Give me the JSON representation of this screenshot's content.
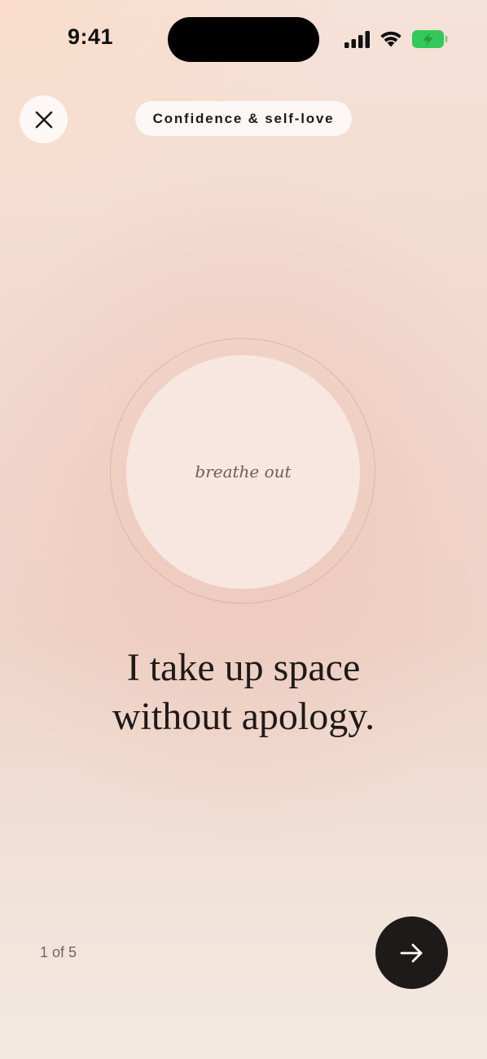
{
  "status_bar": {
    "time": "9:41",
    "icons": [
      "signal-icon",
      "wifi-icon",
      "battery-charging-icon"
    ],
    "battery_color": "#34c759"
  },
  "header": {
    "close_icon": "close-icon",
    "category": "Confidence & self-love"
  },
  "breathing": {
    "prompt": "breathe out"
  },
  "affirmation": {
    "line1": "I take up space",
    "line2": "without apology."
  },
  "footer": {
    "progress": "1 of 5",
    "current": 1,
    "total": 5,
    "next_icon": "arrow-right-icon"
  },
  "colors": {
    "accent_dark": "#1e1a19",
    "pill_bg": "#fdf8f5",
    "circle_bg": "#f8e6e0"
  }
}
